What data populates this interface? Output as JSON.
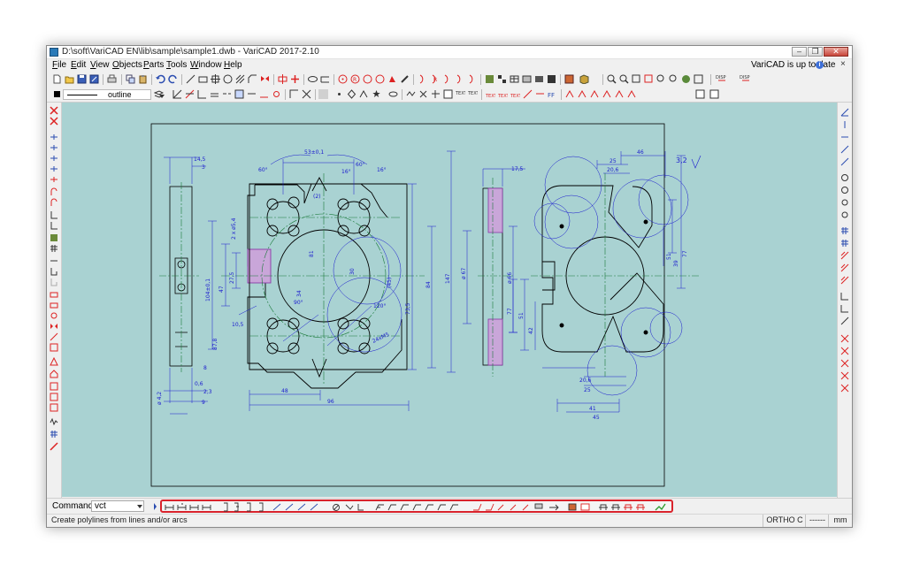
{
  "window": {
    "title": "D:\\soft\\VariCAD EN\\lib\\sample\\sample1.dwb - VariCAD 2017-2.10",
    "minimize_glyph": "–",
    "restore_glyph": "❐",
    "close_glyph": "✕"
  },
  "menu": {
    "items": [
      "File",
      "Edit",
      "View",
      "Objects",
      "Parts",
      "Tools",
      "Window",
      "Help"
    ],
    "update_status": "VariCAD is up to date",
    "close_glyph": "×"
  },
  "toolbar": {
    "line_type": "outline",
    "current_color": "#000000"
  },
  "drawing": {
    "roughness": "3,2",
    "dimensions": {
      "d14_5": "14,5",
      "d3": "3",
      "d53": "53±0,1",
      "d60a": "60°",
      "d60b": "60°",
      "d16a": "16°",
      "d16b": "16°",
      "d2": "(2)",
      "d2x4": "2 x ø5,4",
      "d104": "104±0,1",
      "d47": "47",
      "d27": "27,5",
      "d34": "34",
      "d81": "81",
      "d84": "84",
      "d45": "(45)",
      "d147": "147",
      "d73": "73,5",
      "d30": "30",
      "d90": "90°",
      "d120": "120°",
      "d10": "10,5",
      "d87": "87,8",
      "d8": "8",
      "d48": "48",
      "d96": "96",
      "d2_3": "2,3",
      "d9": "9",
      "d0_6": "0,6",
      "d4_2": "ø 4,2",
      "d24": "24xM5",
      "d17_5": "17,5",
      "d67": "ø 67",
      "d66": "ø 66",
      "d46": "46",
      "d25": "25",
      "d20": "20,6",
      "d39": "39",
      "d51": "51",
      "d77": "77",
      "d42": "42",
      "d77b": "77",
      "d51b": "51",
      "d41": "41",
      "d45b": "45",
      "d25b": "25",
      "d20b": "20,6"
    }
  },
  "command": {
    "label": "Command:",
    "value": "vct"
  },
  "status": {
    "hint": "Create polylines from lines and/or arcs",
    "ortho": "ORTHO C",
    "extra": "------",
    "units": "mm"
  },
  "colors": {
    "canvas": "#a9d2d2",
    "drawing_line": "#000000",
    "dimension": "#1a1acf",
    "center_line": "#1a7a3a",
    "hatch": "#8a3aa6",
    "highlight": "#d9232c"
  }
}
